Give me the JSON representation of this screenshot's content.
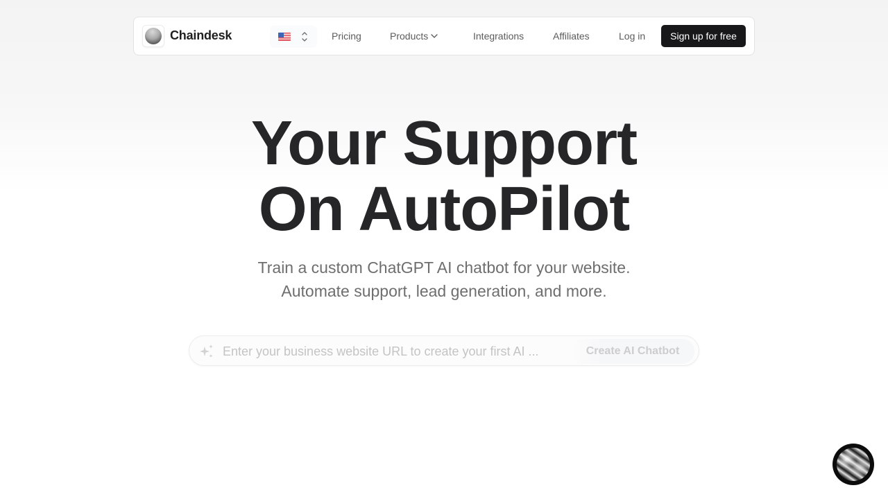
{
  "navbar": {
    "brand": "Chaindesk",
    "language": {
      "flag": "us-flag",
      "icon": "chevron-up-down-icon"
    },
    "links": [
      {
        "label": "Pricing"
      },
      {
        "label": "Products",
        "has_dropdown": true
      },
      {
        "label": "Integrations"
      },
      {
        "label": "Affiliates"
      },
      {
        "label": "Log in"
      }
    ],
    "cta_label": "Sign up for free"
  },
  "hero": {
    "title_line1": "Your Support",
    "title_line2": "On AutoPilot",
    "subtitle_line1": "Train a custom ChatGPT AI chatbot for your website.",
    "subtitle_line2": "Automate support, lead generation, and more."
  },
  "url_form": {
    "icon": "sparkles-icon",
    "value": "",
    "placeholder": "Enter your business website URL to create your first AI ...",
    "button_label": "Create AI Chatbot"
  },
  "chat_widget": {
    "icon": "chat-bubble-avatar"
  },
  "colors": {
    "primary_button": "#18181b",
    "title_text": "#262628",
    "subtitle_text": "#6e6e6e",
    "nav_text": "#5b5b5b"
  }
}
